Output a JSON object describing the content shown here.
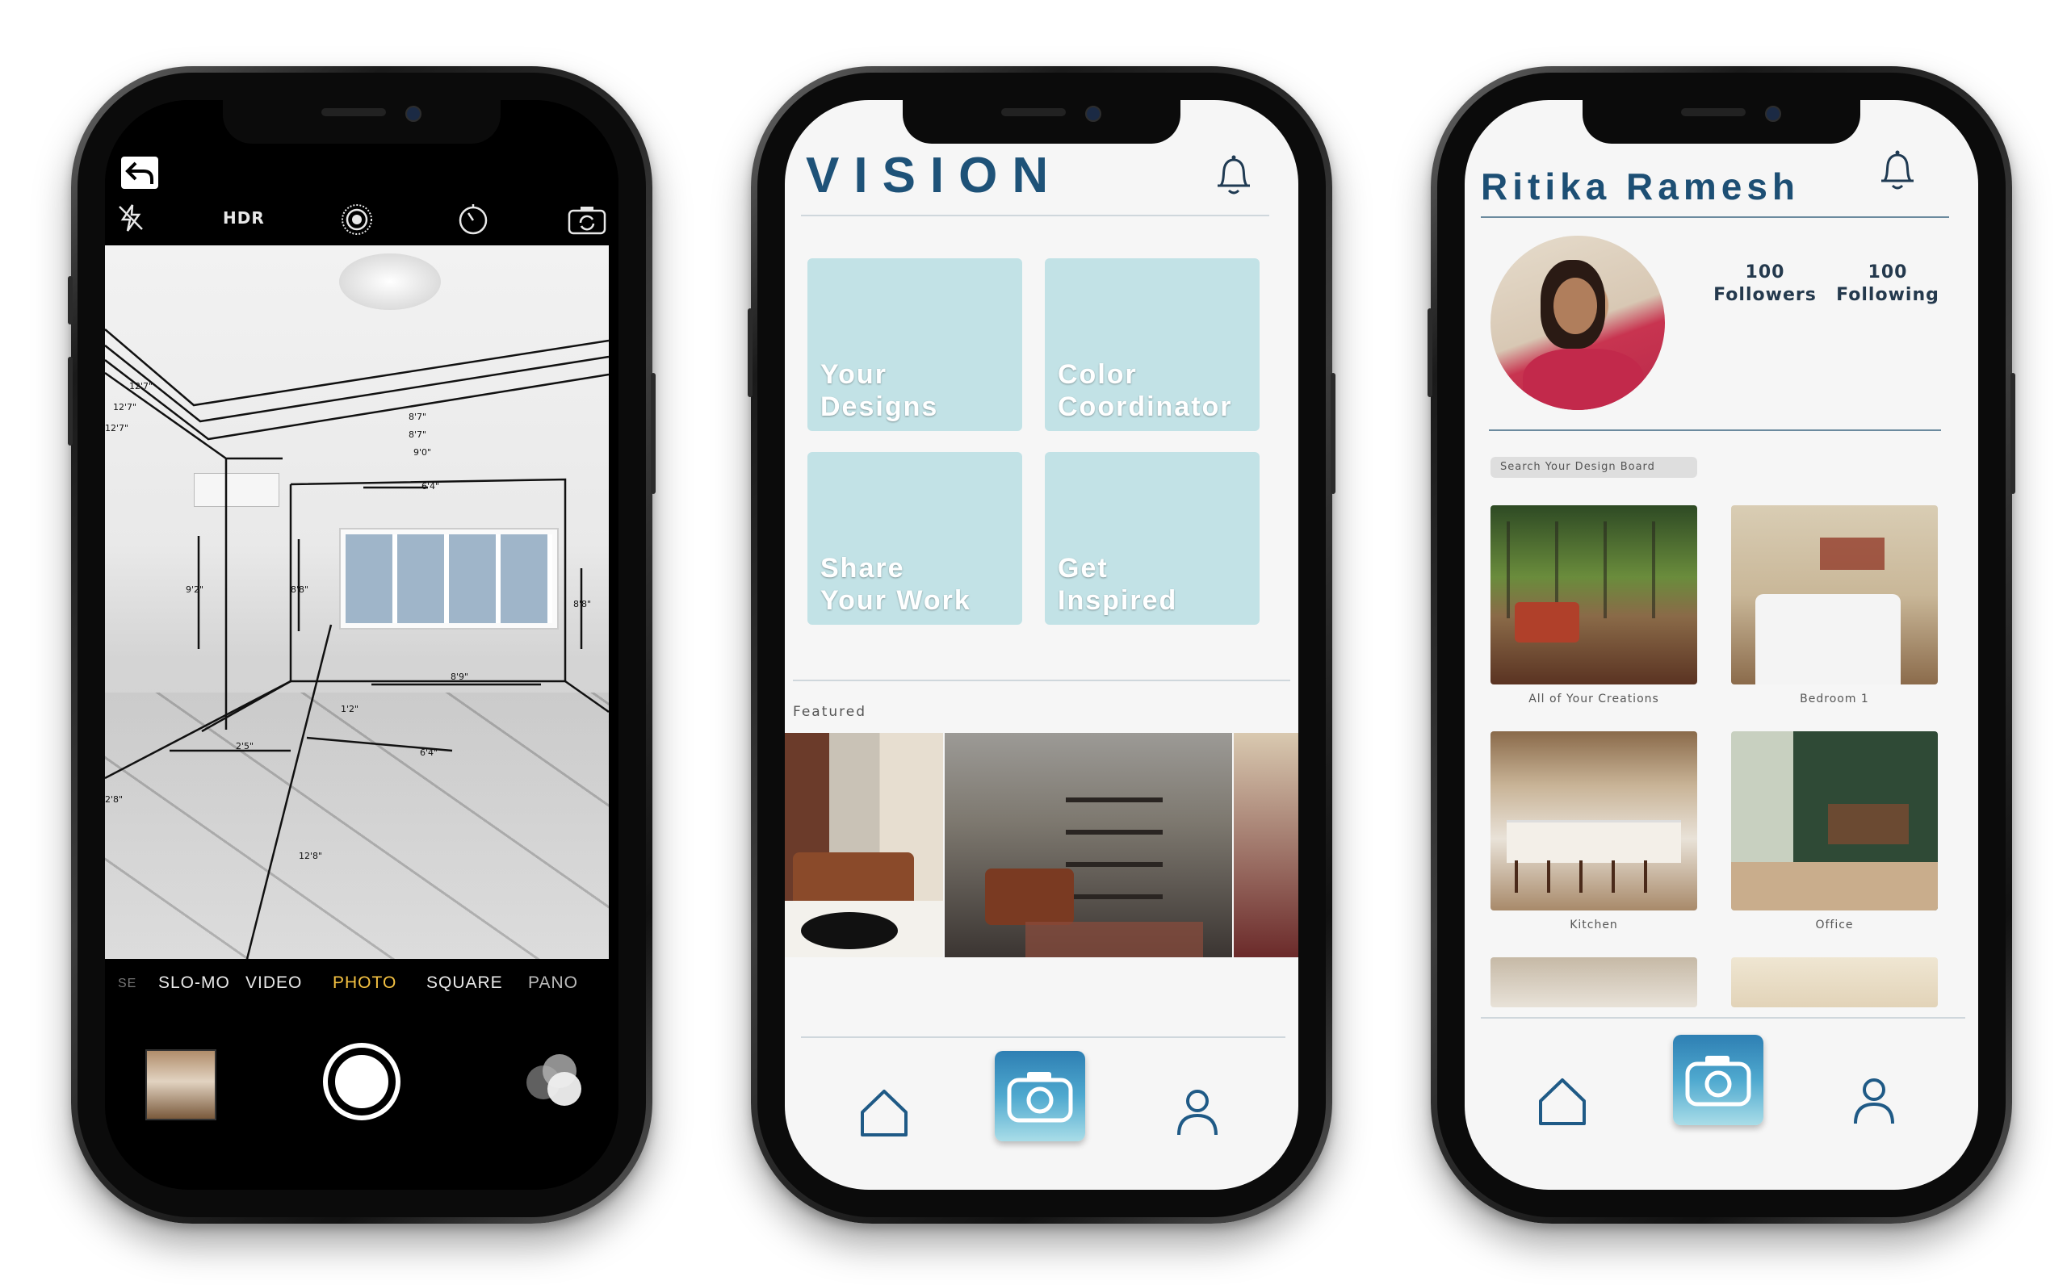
{
  "camera": {
    "top_icons": [
      "flash-off-icon",
      "hdr",
      "live-photo-icon",
      "timer-icon",
      "flip-camera-icon"
    ],
    "hdr_label": "HDR",
    "modes": [
      "SE",
      "SLO-MO",
      "VIDEO",
      "PHOTO",
      "SQUARE",
      "PANO"
    ],
    "active_mode": "PHOTO",
    "accent": "#f5c242",
    "measurements": [
      "12'7\"",
      "12'7\"",
      "12'7\"",
      "8'7\"",
      "8'7\"",
      "9'0\"",
      "6'4\"",
      "9'2\"",
      "8'8\"",
      "8'8\"",
      "8'9\"",
      "2'5\"",
      "6'4\"",
      "2'8\"",
      "12'8\"",
      "1'2\""
    ]
  },
  "home": {
    "title": "VISION",
    "tiles": [
      {
        "label": "Your\nDesigns"
      },
      {
        "label": "Color\nCoordinator"
      },
      {
        "label": "Share\nYour Work"
      },
      {
        "label": "Get\nInspired"
      }
    ],
    "featured_label": "Featured",
    "tile_color": "#c2e2e6",
    "brand_color": "#1e5278"
  },
  "profile": {
    "name": "Ritika Ramesh",
    "followers_count": "100",
    "followers_label": "Followers",
    "following_count": "100",
    "following_label": "Following",
    "search_placeholder": "Search Your Design Board",
    "boards": [
      {
        "caption": "All of Your Creations"
      },
      {
        "caption": "Bedroom 1"
      },
      {
        "caption": "Kitchen"
      },
      {
        "caption": "Office"
      }
    ]
  },
  "nav": [
    "home-icon",
    "camera-icon",
    "user-icon"
  ]
}
